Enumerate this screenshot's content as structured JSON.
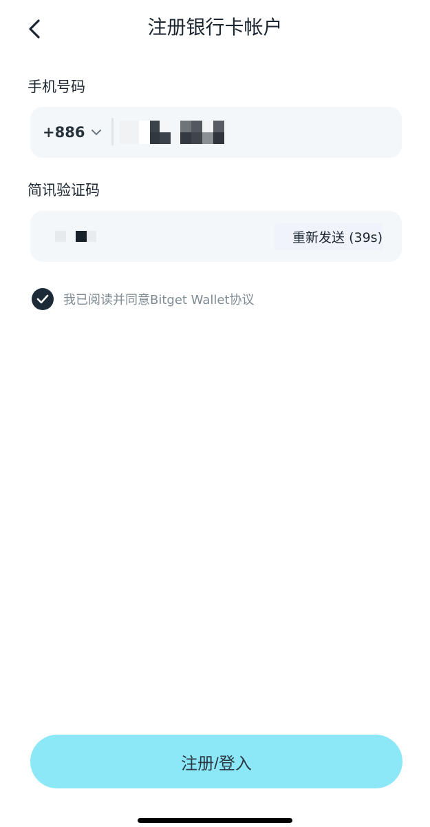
{
  "header": {
    "title": "注册银行卡帐户",
    "back_icon": "chevron-left-icon"
  },
  "phone": {
    "label": "手机号码",
    "country_code": "+886",
    "dropdown_icon": "chevron-down-icon",
    "value_redacted": true
  },
  "sms_code": {
    "label": "简讯验证码",
    "value_redacted": true,
    "resend_label": "重新发送 (39s)"
  },
  "agreement": {
    "checked": true,
    "text": "我已阅读并同意Bitget Wallet协议",
    "check_icon": "check-icon"
  },
  "submit": {
    "label": "注册/登入",
    "color": "#8ce8f6"
  },
  "colors": {
    "accent_dark": "#1b2a36",
    "field_bg": "#f4f7f9"
  }
}
